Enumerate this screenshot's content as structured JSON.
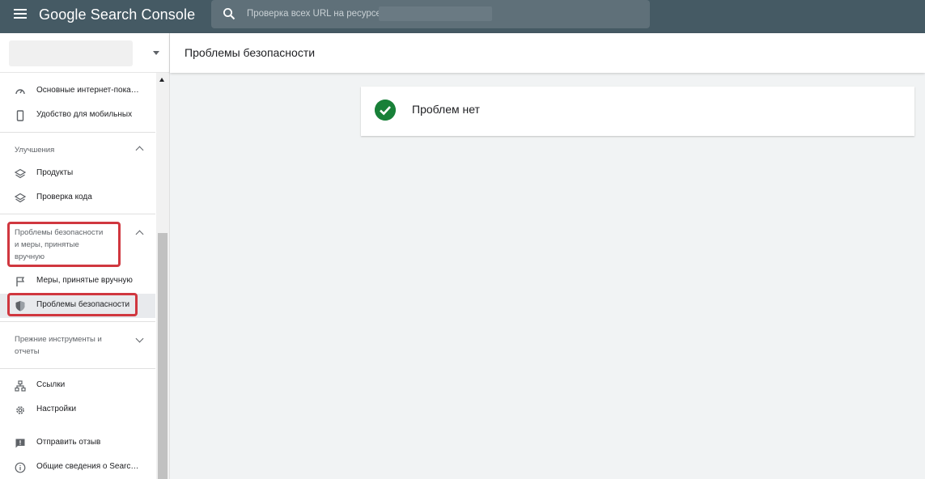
{
  "app": {
    "brand": "Google Search Console"
  },
  "search": {
    "placeholder": "Проверка всех URL на ресурсе"
  },
  "sidebar": {
    "top_items": [
      {
        "label": "Основные интернет-пока…",
        "icon": "gauge-icon"
      },
      {
        "label": "Удобство для мобильных",
        "icon": "smartphone-icon"
      }
    ],
    "enhancements": {
      "title": "Улучшения",
      "items": [
        {
          "label": "Продукты",
          "icon": "layers-icon"
        },
        {
          "label": "Проверка кода",
          "icon": "layers-icon"
        }
      ]
    },
    "security": {
      "title_line1": "Проблемы безопасности",
      "title_line2": "и меры, принятые",
      "title_line3": "вручную",
      "items": [
        {
          "label": "Меры, принятые вручную",
          "icon": "flag-icon"
        },
        {
          "label": "Проблемы безопасности",
          "icon": "shield-icon",
          "active": true
        }
      ]
    },
    "legacy": {
      "title_line1": "Прежние инструменты и",
      "title_line2": "отчеты"
    },
    "bottom_items": [
      {
        "label": "Ссылки",
        "icon": "links-icon"
      },
      {
        "label": "Настройки",
        "icon": "gear-icon"
      },
      {
        "label": "Отправить отзыв",
        "icon": "feedback-icon"
      },
      {
        "label": "Общие сведения о Search…",
        "icon": "info-icon"
      }
    ]
  },
  "main": {
    "title": "Проблемы безопасности",
    "status_text": "Проблем нет",
    "status_icon": "check-circle-icon"
  },
  "colors": {
    "topbar": "#455a64",
    "highlight": "#d0373f",
    "success": "#188038"
  }
}
